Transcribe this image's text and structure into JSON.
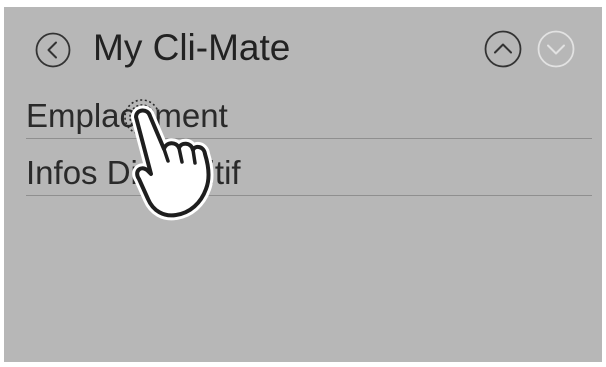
{
  "header": {
    "title": "My Cli-Mate",
    "back_icon": "chevron-left-circle-icon",
    "up_icon": "chevron-up-circle-icon",
    "down_icon": "chevron-down-circle-icon",
    "down_state": "disabled"
  },
  "menu": {
    "items": [
      {
        "label": "Emplacement"
      },
      {
        "label": "Infos Dispositif"
      }
    ]
  },
  "gesture": {
    "icon": "tap-hand-icon",
    "target": "Emplacement"
  },
  "colors": {
    "screen_bg": "#b7b7b7",
    "text": "#222222",
    "divider": "#8f8f8f",
    "icon_active": "#333333",
    "icon_disabled": "#e2e2e2"
  }
}
